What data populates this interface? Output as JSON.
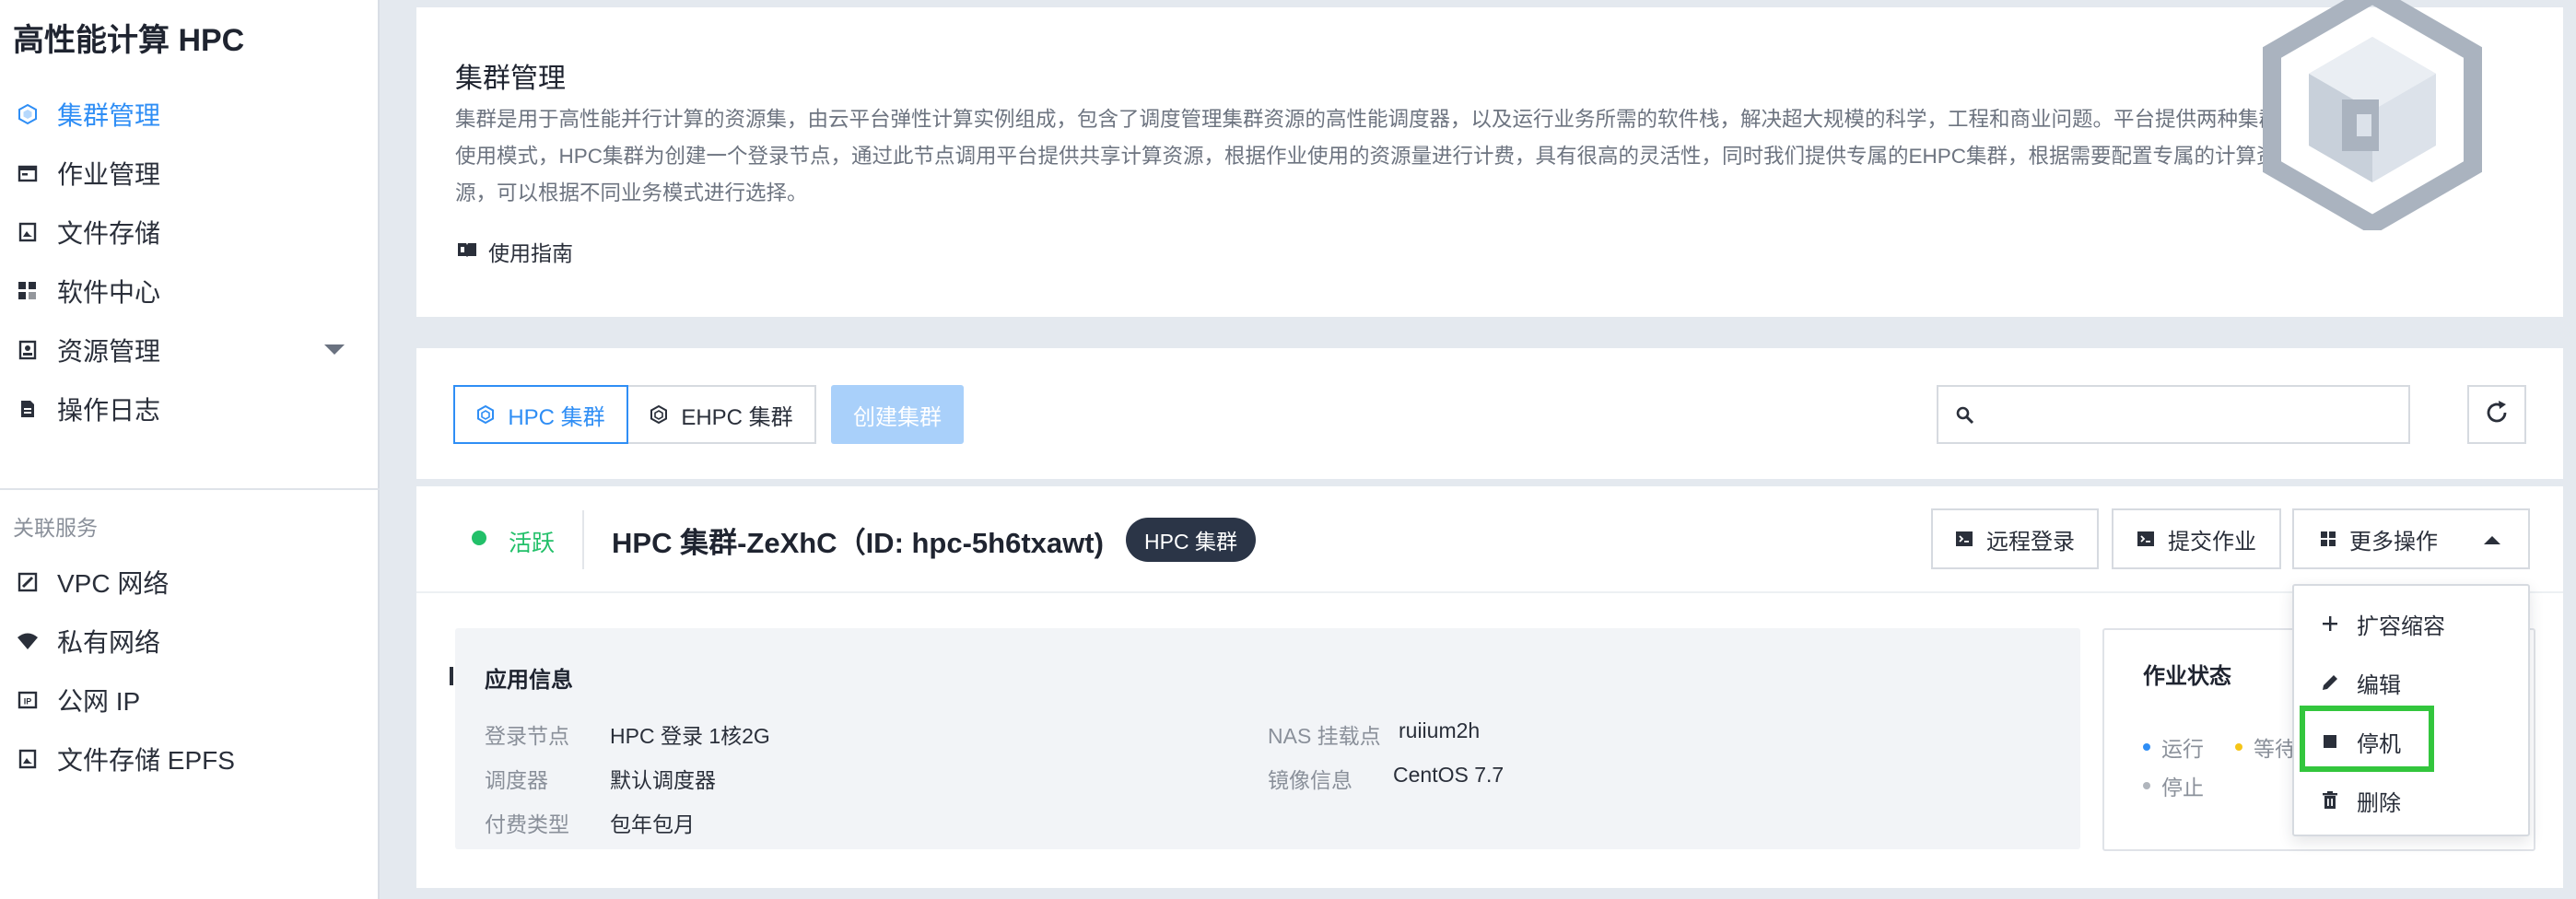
{
  "app": {
    "title": "高性能计算 HPC"
  },
  "sidebar": {
    "items": [
      {
        "label": "集群管理",
        "icon": "hexagon-cube-icon",
        "active": true
      },
      {
        "label": "作业管理",
        "icon": "job-icon"
      },
      {
        "label": "文件存储",
        "icon": "file-storage-icon"
      },
      {
        "label": "软件中心",
        "icon": "grid-icon"
      },
      {
        "label": "资源管理",
        "icon": "resource-icon",
        "expandable": true
      },
      {
        "label": "操作日志",
        "icon": "document-icon"
      }
    ],
    "related_label": "关联服务",
    "related": [
      {
        "label": "VPC 网络",
        "icon": "vpc-icon"
      },
      {
        "label": "私有网络",
        "icon": "wifi-icon"
      },
      {
        "label": "公网 IP",
        "icon": "ip-icon"
      },
      {
        "label": "文件存储 EPFS",
        "icon": "epfs-icon"
      }
    ]
  },
  "intro": {
    "title": "集群管理",
    "desc": "集群是用于高性能并行计算的资源集，由云平台弹性计算实例组成，包含了调度管理集群资源的高性能调度器，以及运行业务所需的软件栈，解决超大规模的科学，工程和商业问题。平台提供两种集群使用模式，HPC集群为创建一个登录节点，通过此节点调用平台提供共享计算资源，根据作业使用的资源量进行计费，具有很高的灵活性，同时我们提供专属的EHPC集群，根据需要配置专属的计算资源，可以根据不同业务模式进行选择。",
    "guide_label": "使用指南"
  },
  "toolbar": {
    "tabs": [
      {
        "label": "HPC 集群",
        "selected": true
      },
      {
        "label": "EHPC 集群",
        "selected": false
      }
    ],
    "create_label": "创建集群",
    "search_placeholder": "",
    "search_value": ""
  },
  "cluster": {
    "status": "活跃",
    "name": "HPC 集群-ZeXhC（ID: hpc-5h6txawt)",
    "badge": "HPC 集群",
    "actions": {
      "remote": "远程登录",
      "submit": "提交作业",
      "more": "更多操作"
    },
    "app_info": {
      "title": "应用信息",
      "login_node_k": "登录节点",
      "login_node_v": "HPC 登录 1核2G",
      "scheduler_k": "调度器",
      "scheduler_v": "默认调度器",
      "billing_k": "付费类型",
      "billing_v": "包年包月",
      "nas_k": "NAS 挂载点",
      "nas_v": "ruiium2h",
      "image_k": "镜像信息",
      "image_v": "CentOS 7.7"
    },
    "job_status": {
      "title": "作业状态",
      "running": "运行",
      "waiting": "等待",
      "stopped": "停止"
    }
  },
  "dropdown": {
    "items": [
      {
        "label": "扩容缩容",
        "icon": "plus-icon"
      },
      {
        "label": "编辑",
        "icon": "pencil-icon"
      },
      {
        "label": "停机",
        "icon": "stop-icon",
        "highlighted": true
      },
      {
        "label": "删除",
        "icon": "trash-icon"
      }
    ]
  },
  "colors": {
    "accent": "#2f8ef5",
    "active_green": "#22c069",
    "highlight": "#33c63d",
    "badge_bg": "#2b3547"
  }
}
